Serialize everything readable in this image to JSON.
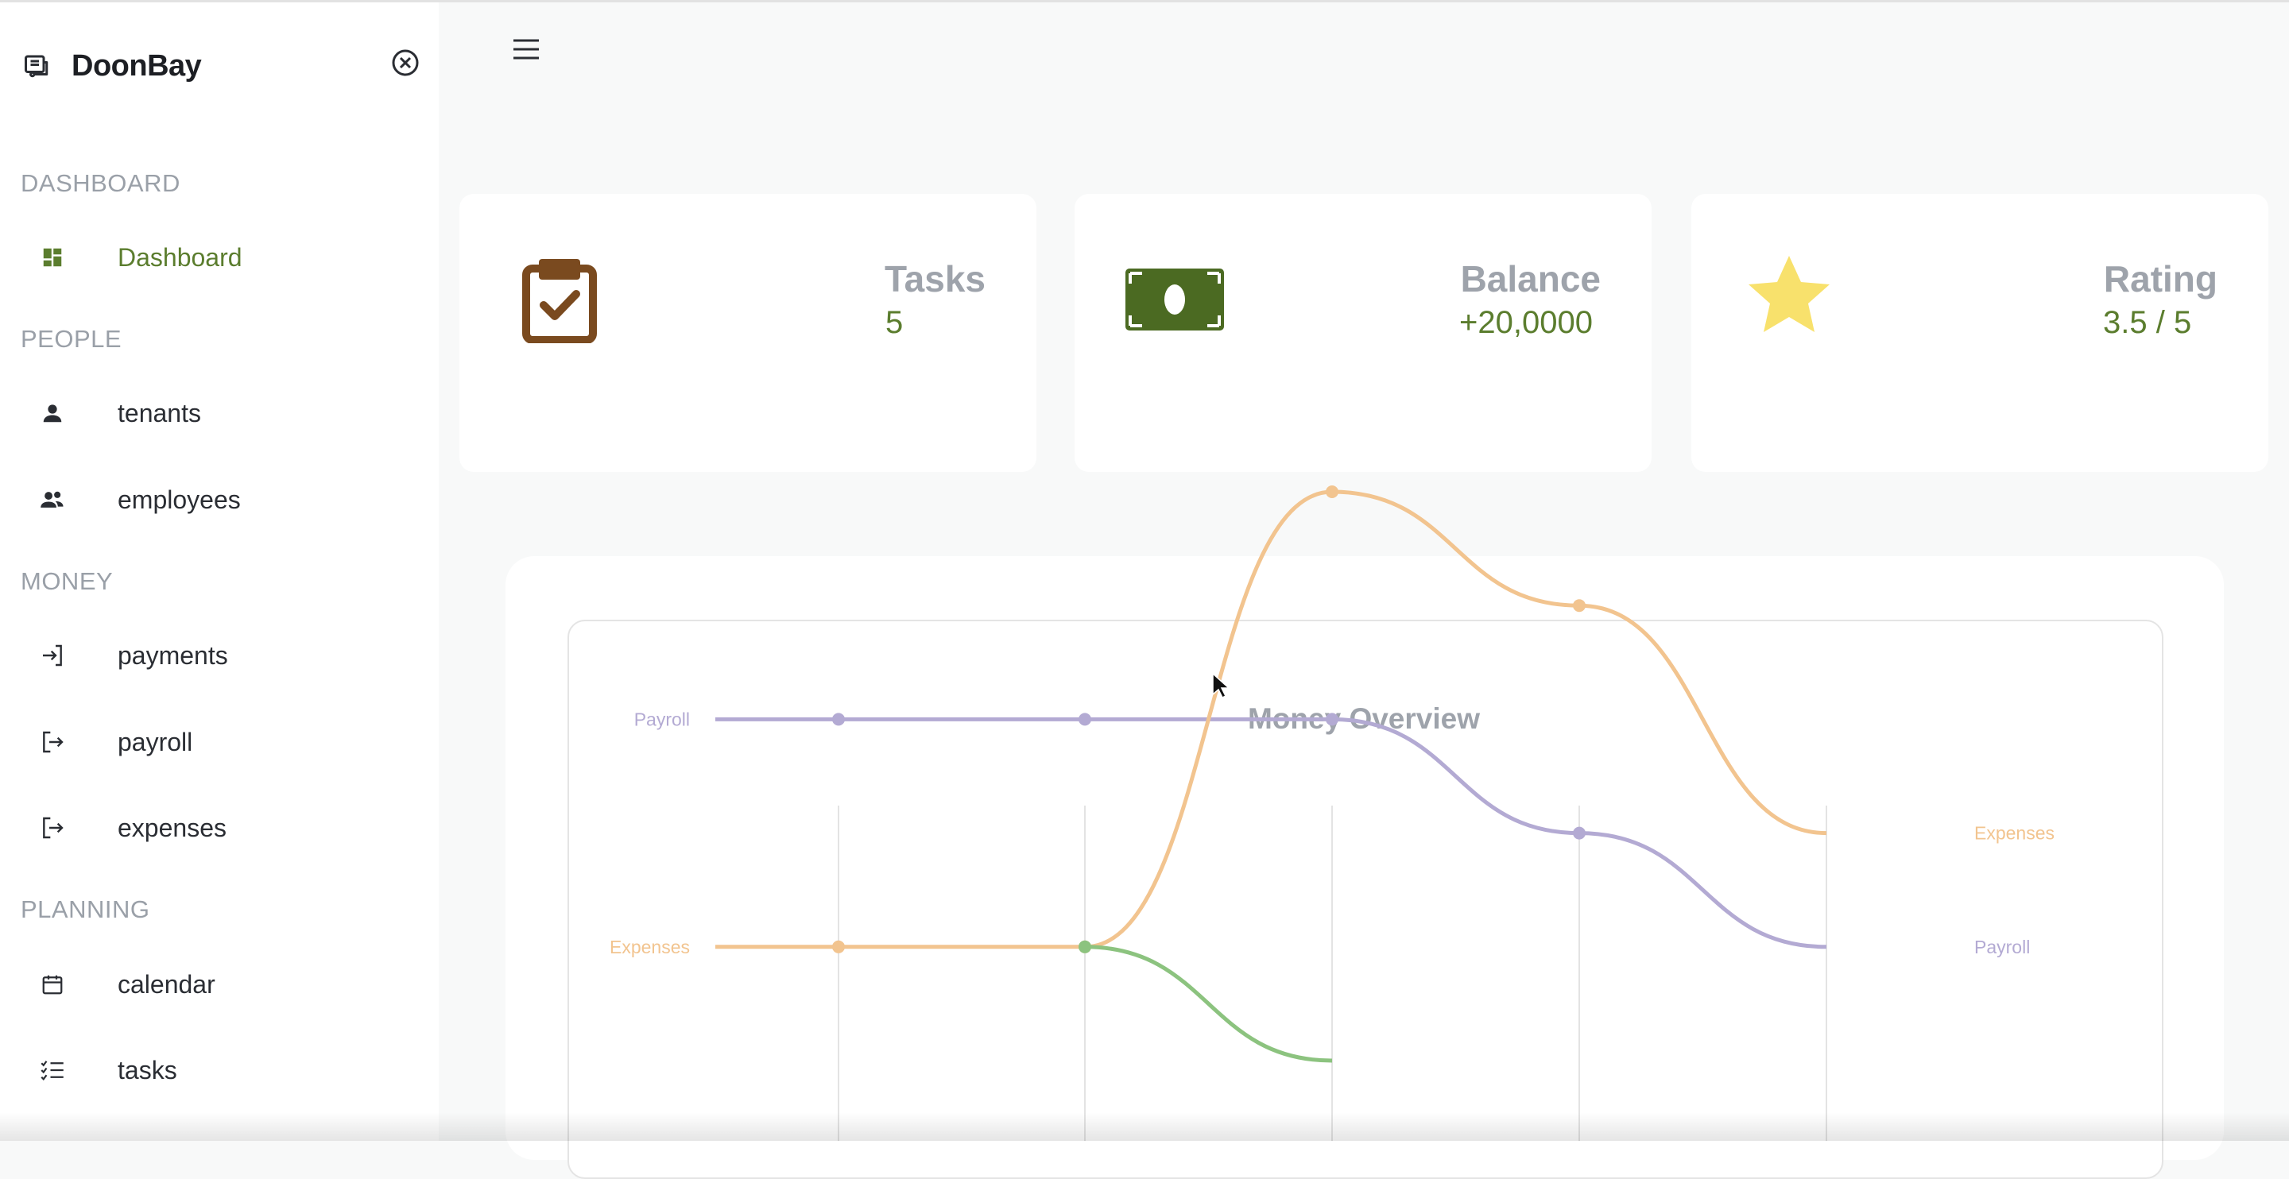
{
  "app": {
    "name": "DoonBay"
  },
  "sidebar": {
    "sections": [
      {
        "label": "DASHBOARD"
      },
      {
        "label": "PEOPLE"
      },
      {
        "label": "MONEY"
      },
      {
        "label": "PLANNING"
      }
    ],
    "items": [
      {
        "label": "Dashboard",
        "icon": "dashboard-icon",
        "active": true
      },
      {
        "label": "tenants",
        "icon": "person-icon"
      },
      {
        "label": "employees",
        "icon": "people-icon"
      },
      {
        "label": "payments",
        "icon": "login-icon"
      },
      {
        "label": "payroll",
        "icon": "logout-icon"
      },
      {
        "label": "expenses",
        "icon": "logout-icon"
      },
      {
        "label": "calendar",
        "icon": "calendar-icon"
      },
      {
        "label": "tasks",
        "icon": "checklist-icon"
      }
    ]
  },
  "stats": [
    {
      "title": "Tasks",
      "value": "5",
      "icon": "clipboard-check-icon"
    },
    {
      "title": "Balance",
      "value": "+20,0000",
      "icon": "banknote-icon"
    },
    {
      "title": "Rating",
      "value": "3.5 / 5",
      "icon": "star-icon"
    }
  ],
  "colors": {
    "accent": "#5b7d2e",
    "clipboard": "#7a4a1f",
    "banknote": "#4b6a22",
    "star": "#f8e16c",
    "payroll": "#b3aad3",
    "expenses": "#f2c48f",
    "payments": "#8cc37f"
  },
  "chart_data": {
    "type": "line",
    "title": "Money Overview",
    "series": [
      {
        "name": "Payroll",
        "values": [
          3,
          3,
          3,
          3,
          2,
          1
        ]
      },
      {
        "name": "Expenses",
        "values": [
          1,
          1,
          1,
          5,
          4,
          2
        ]
      },
      {
        "name": "",
        "values": [
          null,
          null,
          1,
          0
        ]
      }
    ],
    "ylim": [
      -1.5,
      6
    ],
    "grid": true,
    "legend": "line-end labels"
  }
}
